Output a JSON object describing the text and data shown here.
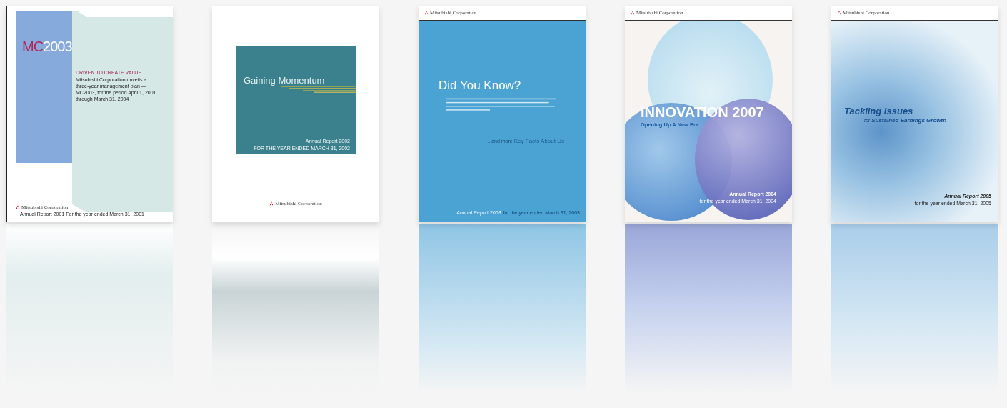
{
  "covers": [
    {
      "kind": "mc2003",
      "title_prefix": "MC",
      "title_suffix": "2003",
      "heading": "DRIVEN TO CREATE VALUE",
      "body": "Mitsubishi Corporation unveils a three-year management plan — MC2003, for the period April 1, 2001 through March 31, 2004",
      "logo": "Mitsubishi Corporation",
      "footer": "Annual Report 2001  For the year ended March 31, 2001"
    },
    {
      "kind": "momentum",
      "title": "Gaining Momentum",
      "report": "Annual Report 2002",
      "period": "FOR THE YEAR ENDED MARCH 31, 2002",
      "logo": "Mitsubishi Corporation"
    },
    {
      "kind": "didyouknow",
      "logo": "Mitsubishi Corporation",
      "title": "Did You Know?",
      "lead": "...and more",
      "subtitle": "Key Facts About Us",
      "report": "Annual Report 2003",
      "period": "for the year ended March 31, 2003"
    },
    {
      "kind": "innovation",
      "logo": "Mitsubishi Corporation",
      "title": "INNOVATION 2007",
      "subtitle": "Opening Up A New Era",
      "report": "Annual Report 2004",
      "period": "for the year ended March 31, 2004"
    },
    {
      "kind": "tackling",
      "logo": "Mitsubishi Corporation",
      "title": "Tackling Issues",
      "lead": "for",
      "subtitle": "Sustained Earnings Growth",
      "report": "Annual Report 2005",
      "period": "for the year ended March 31, 2005"
    }
  ]
}
